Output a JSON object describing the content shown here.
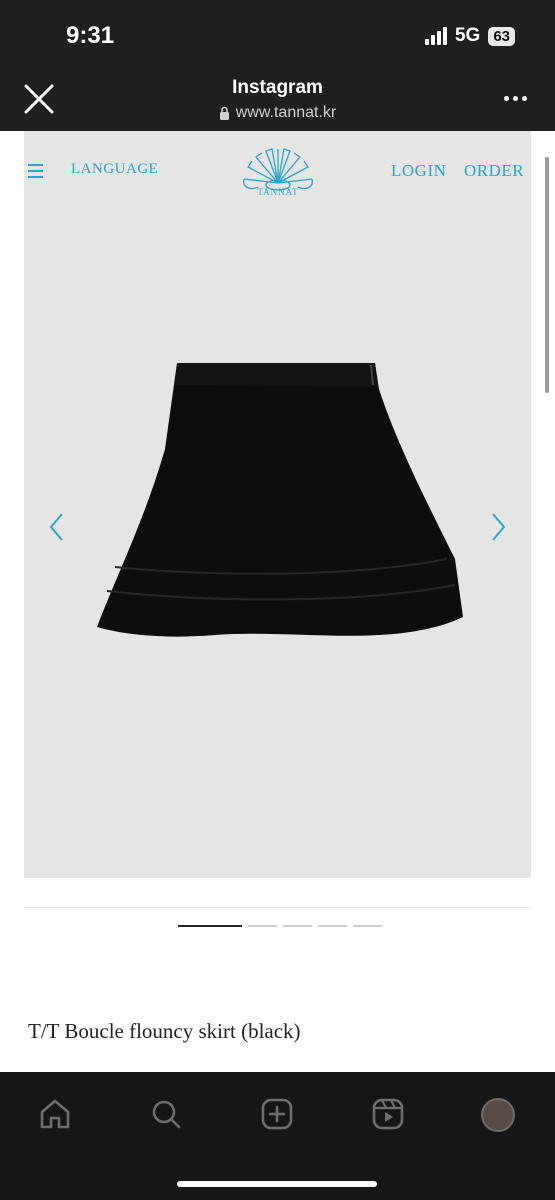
{
  "status_bar": {
    "time": "9:31",
    "network": "5G",
    "battery": "63"
  },
  "browser": {
    "app_title": "Instagram",
    "url": "www.tannat.kr",
    "close_icon": "close-icon",
    "more_icon": "more-icon",
    "lock_icon": "lock-icon"
  },
  "site": {
    "nav": {
      "language_label": "LANGUAGE",
      "login_label": "LOGIN",
      "order_label": "ORDER"
    },
    "logo_text": "TANNAT",
    "accent_color": "#2aa7cf"
  },
  "carousel": {
    "slide_count": 5,
    "active_index": 0
  },
  "product": {
    "name": "T/T Boucle flouncy skirt (black)"
  },
  "tabbar": {
    "items": [
      "home-icon",
      "search-icon",
      "create-icon",
      "reels-icon",
      "profile-avatar"
    ]
  }
}
